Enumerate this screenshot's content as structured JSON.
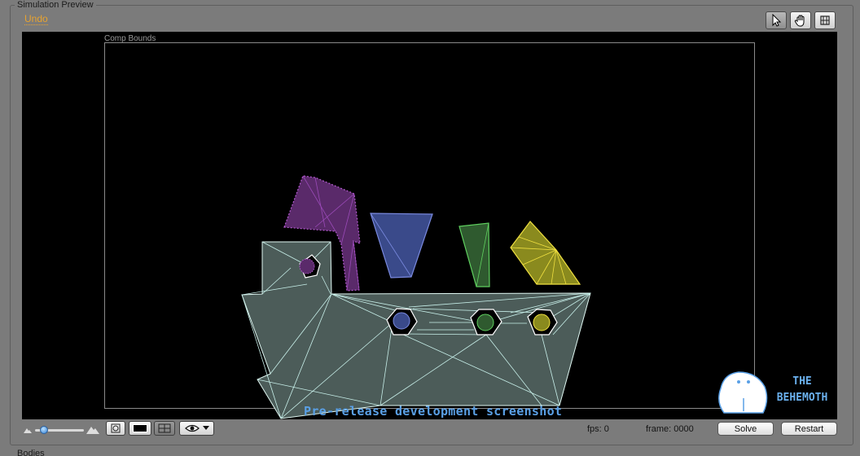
{
  "panel": {
    "title": "Simulation Preview",
    "undo_label": "Undo"
  },
  "tools": [
    {
      "name": "arrow-tool-icon",
      "active": true
    },
    {
      "name": "hand-tool-icon",
      "active": false
    },
    {
      "name": "grid-tool-icon",
      "active": false
    }
  ],
  "canvas": {
    "comp_bounds_label": "Comp Bounds",
    "watermark": "Pre-release development screenshot",
    "logo_line1": "THE",
    "logo_line2": "BEHEMOTH",
    "colors": {
      "background": "#000000",
      "container": "#4c5c59",
      "purple": "#5a2a6a",
      "blue": "#3a4a8a",
      "green": "#2f5a2f",
      "yellow": "#8a8a1e",
      "mesh": "#c8f0ea"
    }
  },
  "bottom": {
    "fps_label": "fps: 0",
    "frame_label": "frame: 0000",
    "solve_label": "Solve",
    "restart_label": "Restart"
  },
  "footer": {
    "next_section": "Bodies"
  }
}
